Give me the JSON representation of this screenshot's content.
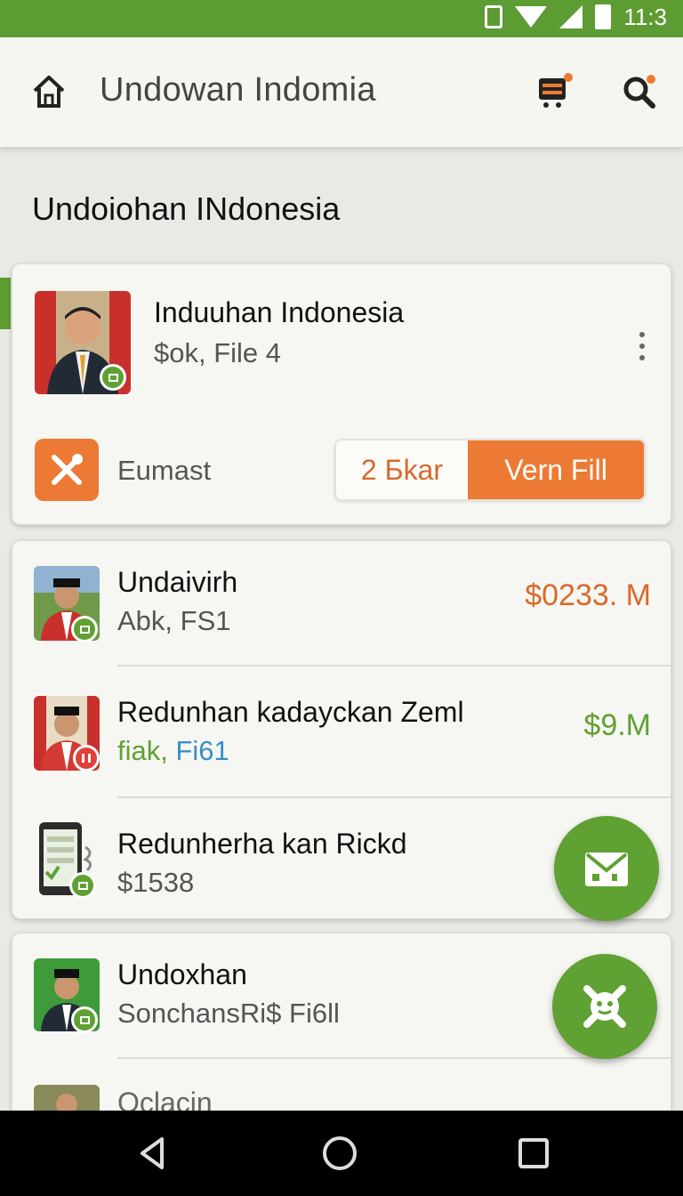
{
  "status_bar": {
    "time": "11:3",
    "icons": [
      "phone-icon",
      "wifi-icon",
      "signal-icon",
      "battery-icon"
    ]
  },
  "app_bar": {
    "title": "Undowan Indomia",
    "icons": [
      "home-icon",
      "cart-icon",
      "search-icon"
    ]
  },
  "section": {
    "title": "Undoiohan INdonesia"
  },
  "featured": {
    "title": "Induuhan Indonesia",
    "subtitle": "$ok, File 4",
    "action_label": "Eumast",
    "segment_left": "2 Бkar",
    "segment_right": "Vern Fill"
  },
  "list": [
    {
      "title": "Undaivirh",
      "subtitle": "Abk, FS1",
      "price": "$0233. M",
      "price_color": "#d9692c"
    },
    {
      "title": "Redunhan kadayckan Zeml",
      "subtitle_green": "fiak, ",
      "subtitle_blue": "Fi61",
      "price": "$9.M",
      "price_color": "#5fa133"
    },
    {
      "title": "Redunherha kan Rickd",
      "subtitle": "$1538"
    }
  ],
  "list2": [
    {
      "title": "Undoxhan",
      "subtitle": "SonchansRi$ Fi6ll"
    },
    {
      "title": "Oclacin"
    }
  ],
  "colors": {
    "brand_green": "#5d9c33",
    "accent_orange": "#ec7a34"
  },
  "nav": {
    "icons": [
      "back-icon",
      "home-circle-icon",
      "recents-icon"
    ]
  }
}
